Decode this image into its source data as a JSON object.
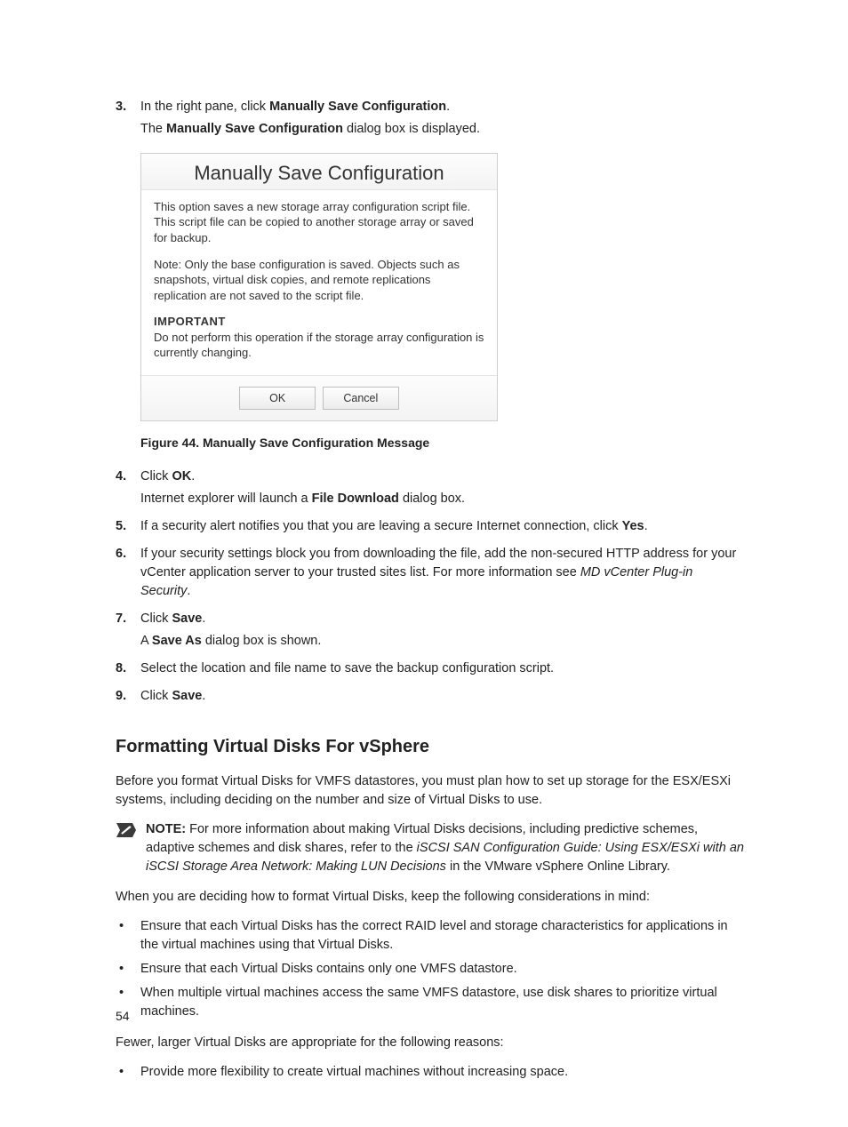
{
  "steps": {
    "s3": {
      "num": "3.",
      "l1a": "In the right pane, click ",
      "l1b": "Manually Save Configuration",
      "l1c": ".",
      "l2a": "The ",
      "l2b": "Manually Save Configuration",
      "l2c": " dialog box is displayed."
    },
    "s4": {
      "num": "4.",
      "l1a": "Click ",
      "l1b": "OK",
      "l1c": ".",
      "l2a": "Internet explorer will launch a ",
      "l2b": "File Download",
      "l2c": " dialog box."
    },
    "s5": {
      "num": "5.",
      "l1a": "If a security alert notifies you that you are leaving a secure Internet connection, click ",
      "l1b": "Yes",
      "l1c": "."
    },
    "s6": {
      "num": "6.",
      "l1a": "If your security settings block you from downloading the file, add the non-secured HTTP address for your vCenter application server to your trusted sites list. For more information see ",
      "l1b": "MD vCenter Plug-in Security",
      "l1c": "."
    },
    "s7": {
      "num": "7.",
      "l1a": "Click ",
      "l1b": "Save",
      "l1c": ".",
      "l2a": "A ",
      "l2b": "Save As",
      "l2c": " dialog box is shown."
    },
    "s8": {
      "num": "8.",
      "l1": "Select the location and file name to save the backup configuration script."
    },
    "s9": {
      "num": "9.",
      "l1a": "Click ",
      "l1b": "Save",
      "l1c": "."
    }
  },
  "dialog": {
    "title": "Manually Save Configuration",
    "p1": "This option saves a new storage array configuration script file. This script file can be copied to another storage array or saved for backup.",
    "p2": "Note: Only the base configuration is saved. Objects such as snapshots, virtual disk copies, and remote replications replication are not saved to the script file.",
    "imp_label": "IMPORTANT",
    "imp_text": "Do not perform this operation if the storage array configuration is currently changing.",
    "ok": "OK",
    "cancel": "Cancel"
  },
  "fig_caption": "Figure 44. Manually Save Configuration Message",
  "section_heading": "Formatting Virtual Disks For vSphere",
  "p_intro": "Before you format Virtual Disks for VMFS datastores, you must plan how to set up storage for the ESX/ESXi systems, including deciding on the number and size of Virtual Disks to use.",
  "note": {
    "label": "NOTE: ",
    "t1": "For more information about making Virtual Disks decisions, including predictive schemes, adaptive schemes and disk shares, refer to the ",
    "i1": "iSCSI SAN Configuration Guide: Using ESX/ESXi with an iSCSI Storage Area Network: Making LUN Decisions",
    "t2": " in the VMware vSphere Online Library."
  },
  "p_consider": "When you are deciding how to format Virtual Disks, keep the following considerations in mind:",
  "bullets1": {
    "b1": "Ensure that each Virtual Disks has the correct RAID level and storage characteristics for applications in the virtual machines using that Virtual Disks.",
    "b2": "Ensure that each Virtual Disks contains only one VMFS datastore.",
    "b3": "When multiple virtual machines access the same VMFS datastore, use disk shares to prioritize virtual machines."
  },
  "p_fewer": "Fewer, larger Virtual Disks are appropriate for the following reasons:",
  "bullets2": {
    "b1": "Provide more flexibility to create virtual machines without increasing space."
  },
  "page_number": "54"
}
